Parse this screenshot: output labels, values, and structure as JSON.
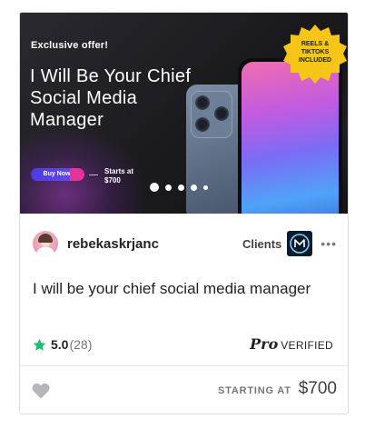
{
  "banner": {
    "offer_text": "Exclusive offer!",
    "headline": "I Will Be Your Chief Social Media Manager",
    "buy_button": "Buy Now",
    "starts_at": "Starts at",
    "starts_price": "$700",
    "badge_lines": [
      "REELS &",
      "TIKTOKS",
      "INCLUDED"
    ],
    "carousel": {
      "total_dots": 5,
      "active_index": 0
    }
  },
  "seller": {
    "username": "rebekaskrjanc",
    "clients_label": "Clients",
    "more_icon": "ellipsis-icon"
  },
  "gig": {
    "title": "I will be your chief social media manager",
    "rating": "5.0",
    "review_count": "(28)",
    "pro_label": "Pro",
    "verified_label": "VERIFIED"
  },
  "footer": {
    "starting_at_label": "STARTING AT",
    "price": "$700"
  },
  "colors": {
    "star": "#1dbf73",
    "text_dark": "#222325",
    "text_muted": "#74767e",
    "badge": "#f5c518",
    "heart": "#b5b6ba"
  }
}
